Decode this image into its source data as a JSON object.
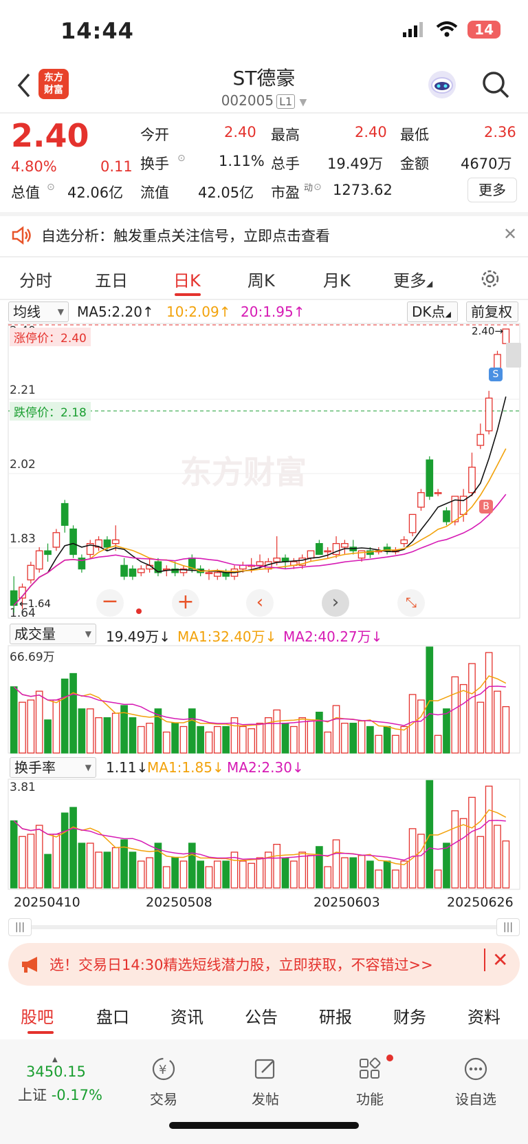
{
  "status": {
    "time": "14:44",
    "battery": "14"
  },
  "nav": {
    "logo": "东方\n财富",
    "title": "ST德豪",
    "code": "002005",
    "level": "L1"
  },
  "quote": {
    "price": "2.40",
    "pct": "4.80%",
    "chg": "0.11",
    "rows": [
      [
        {
          "k": "今开",
          "v": "2.40",
          "c": "red"
        },
        {
          "k": "最高",
          "v": "2.40",
          "c": "red"
        },
        {
          "k": "最低",
          "v": "2.36",
          "c": "red"
        }
      ],
      [
        {
          "k": "换手",
          "v": "1.11%",
          "c": ""
        },
        {
          "k": "总手",
          "v": "19.49万",
          "c": ""
        },
        {
          "k": "金额",
          "v": "4670万",
          "c": ""
        }
      ],
      [
        {
          "k": "总值",
          "v": "42.06亿",
          "c": ""
        },
        {
          "k": "流值",
          "v": "42.05亿",
          "c": ""
        },
        {
          "k": "市盈",
          "sup": "动",
          "v": "1273.62",
          "c": ""
        }
      ]
    ],
    "more": "更多"
  },
  "alert": {
    "text": "自选分析：触发重点关注信号，立即点击查看"
  },
  "tabs": [
    "分时",
    "五日",
    "日K",
    "周K",
    "月K",
    "更多"
  ],
  "kline": {
    "select": "均线",
    "ma5": "MA5:2.20",
    "ma10": "10:2.09",
    "ma20": "20:1.95",
    "dk": "DK点",
    "fq": "前复权",
    "limit_up": "涨停价：2.40",
    "limit_down": "跌停价：2.18",
    "y_labels": [
      "2.40",
      "2.21",
      "2.02",
      "1.83",
      "1.64"
    ],
    "hi_label": "2.40",
    "lo_label": "1.64",
    "watermark": "东方财富",
    "sell": "S",
    "buy": "B"
  },
  "volume": {
    "select": "成交量",
    "val": "19.49万",
    "ma1": "MA1:32.40万",
    "ma2": "MA2:40.27万",
    "max": "66.69万"
  },
  "turnover": {
    "select": "换手率",
    "val": "1.11",
    "ma1": "MA1:1.85",
    "ma2": "MA2:2.30",
    "max": "3.81"
  },
  "dates": [
    "20250410",
    "20250508",
    "20250603",
    "20250626"
  ],
  "banner": {
    "text": "选！交易日14:30精选短线潜力股，立即获取，不容错过>>"
  },
  "bottom_tabs": [
    "股吧",
    "盘口",
    "资讯",
    "公告",
    "研报",
    "财务",
    "资料"
  ],
  "dock": {
    "index_val": "3450.15",
    "index_name": "上证",
    "index_chg": "-0.17%",
    "items": [
      "交易",
      "发帖",
      "功能",
      "设自选"
    ]
  },
  "colors": {
    "up": "#e4322d",
    "down": "#1a9e30",
    "ma10": "#f2a20b",
    "ma20": "#d61ab4"
  },
  "chart_data": {
    "type": "candlestick",
    "ohlc": [
      [
        1.68,
        1.72,
        1.62,
        1.64
      ],
      [
        1.66,
        1.7,
        1.63,
        1.69
      ],
      [
        1.71,
        1.76,
        1.7,
        1.75
      ],
      [
        1.74,
        1.8,
        1.73,
        1.79
      ],
      [
        1.79,
        1.81,
        1.76,
        1.78
      ],
      [
        1.8,
        1.85,
        1.79,
        1.84
      ],
      [
        1.92,
        1.93,
        1.84,
        1.86
      ],
      [
        1.85,
        1.86,
        1.77,
        1.78
      ],
      [
        1.77,
        1.78,
        1.73,
        1.74
      ],
      [
        1.78,
        1.82,
        1.77,
        1.81
      ],
      [
        1.8,
        1.83,
        1.79,
        1.82
      ],
      [
        1.82,
        1.83,
        1.79,
        1.8
      ],
      [
        1.81,
        1.86,
        1.79,
        1.82
      ],
      [
        1.75,
        1.77,
        1.71,
        1.72
      ],
      [
        1.74,
        1.75,
        1.71,
        1.72
      ],
      [
        1.73,
        1.75,
        1.72,
        1.74
      ],
      [
        1.74,
        1.77,
        1.73,
        1.75
      ],
      [
        1.76,
        1.77,
        1.72,
        1.73
      ],
      [
        1.74,
        1.75,
        1.72,
        1.74
      ],
      [
        1.74,
        1.76,
        1.72,
        1.73
      ],
      [
        1.73,
        1.75,
        1.72,
        1.74
      ],
      [
        1.77,
        1.78,
        1.73,
        1.74
      ],
      [
        1.74,
        1.75,
        1.72,
        1.73
      ],
      [
        1.73,
        1.74,
        1.71,
        1.73
      ],
      [
        1.72,
        1.74,
        1.71,
        1.73
      ],
      [
        1.73,
        1.74,
        1.71,
        1.72
      ],
      [
        1.72,
        1.75,
        1.71,
        1.74
      ],
      [
        1.74,
        1.76,
        1.73,
        1.75
      ],
      [
        1.75,
        1.77,
        1.73,
        1.75
      ],
      [
        1.75,
        1.78,
        1.74,
        1.76
      ],
      [
        1.74,
        1.77,
        1.73,
        1.76
      ],
      [
        1.76,
        1.83,
        1.75,
        1.77
      ],
      [
        1.77,
        1.78,
        1.74,
        1.76
      ],
      [
        1.75,
        1.77,
        1.74,
        1.76
      ],
      [
        1.75,
        1.78,
        1.74,
        1.77
      ],
      [
        1.77,
        1.79,
        1.76,
        1.79
      ],
      [
        1.81,
        1.82,
        1.78,
        1.78
      ],
      [
        1.79,
        1.8,
        1.77,
        1.79
      ],
      [
        1.78,
        1.83,
        1.77,
        1.81
      ],
      [
        1.8,
        1.82,
        1.78,
        1.81
      ],
      [
        1.8,
        1.82,
        1.78,
        1.79
      ],
      [
        1.77,
        1.79,
        1.76,
        1.79
      ],
      [
        1.79,
        1.8,
        1.77,
        1.78
      ],
      [
        1.79,
        1.8,
        1.78,
        1.79
      ],
      [
        1.8,
        1.81,
        1.78,
        1.79
      ],
      [
        1.79,
        1.8,
        1.78,
        1.79
      ],
      [
        1.81,
        1.83,
        1.8,
        1.82
      ],
      [
        1.84,
        1.89,
        1.83,
        1.89
      ],
      [
        1.91,
        1.96,
        1.9,
        1.95
      ],
      [
        2.04,
        2.05,
        1.93,
        1.94
      ],
      [
        1.95,
        1.96,
        1.94,
        1.95
      ],
      [
        1.9,
        1.91,
        1.86,
        1.87
      ],
      [
        1.87,
        1.94,
        1.86,
        1.94
      ],
      [
        1.89,
        1.96,
        1.87,
        1.94
      ],
      [
        1.95,
        2.06,
        1.94,
        2.02
      ],
      [
        2.08,
        2.14,
        2.07,
        2.11
      ],
      [
        2.12,
        2.23,
        2.11,
        2.21
      ],
      [
        2.28,
        2.34,
        2.27,
        2.33
      ],
      [
        2.36,
        2.4,
        2.36,
        2.4
      ]
    ]
  }
}
